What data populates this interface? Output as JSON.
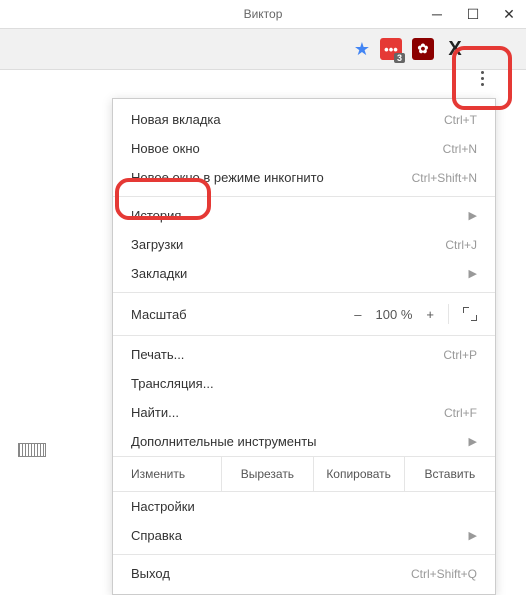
{
  "window": {
    "title": "Виктор"
  },
  "ext_badge": "3",
  "menu": {
    "new_tab": {
      "label": "Новая вкладка",
      "shortcut": "Ctrl+T"
    },
    "new_window": {
      "label": "Новое окно",
      "shortcut": "Ctrl+N"
    },
    "incognito": {
      "label": "Новое окно в режиме инкогнито",
      "shortcut": "Ctrl+Shift+N"
    },
    "history": {
      "label": "История"
    },
    "downloads": {
      "label": "Загрузки",
      "shortcut": "Ctrl+J"
    },
    "bookmarks": {
      "label": "Закладки"
    },
    "zoom": {
      "label": "Масштаб",
      "minus": "–",
      "value": "100 %",
      "plus": "+"
    },
    "print": {
      "label": "Печать...",
      "shortcut": "Ctrl+P"
    },
    "cast": {
      "label": "Трансляция..."
    },
    "find": {
      "label": "Найти...",
      "shortcut": "Ctrl+F"
    },
    "more_tools": {
      "label": "Дополнительные инструменты"
    },
    "edit": {
      "label": "Изменить",
      "cut": "Вырезать",
      "copy": "Копировать",
      "paste": "Вставить"
    },
    "settings": {
      "label": "Настройки"
    },
    "help": {
      "label": "Справка"
    },
    "exit": {
      "label": "Выход",
      "shortcut": "Ctrl+Shift+Q"
    }
  }
}
